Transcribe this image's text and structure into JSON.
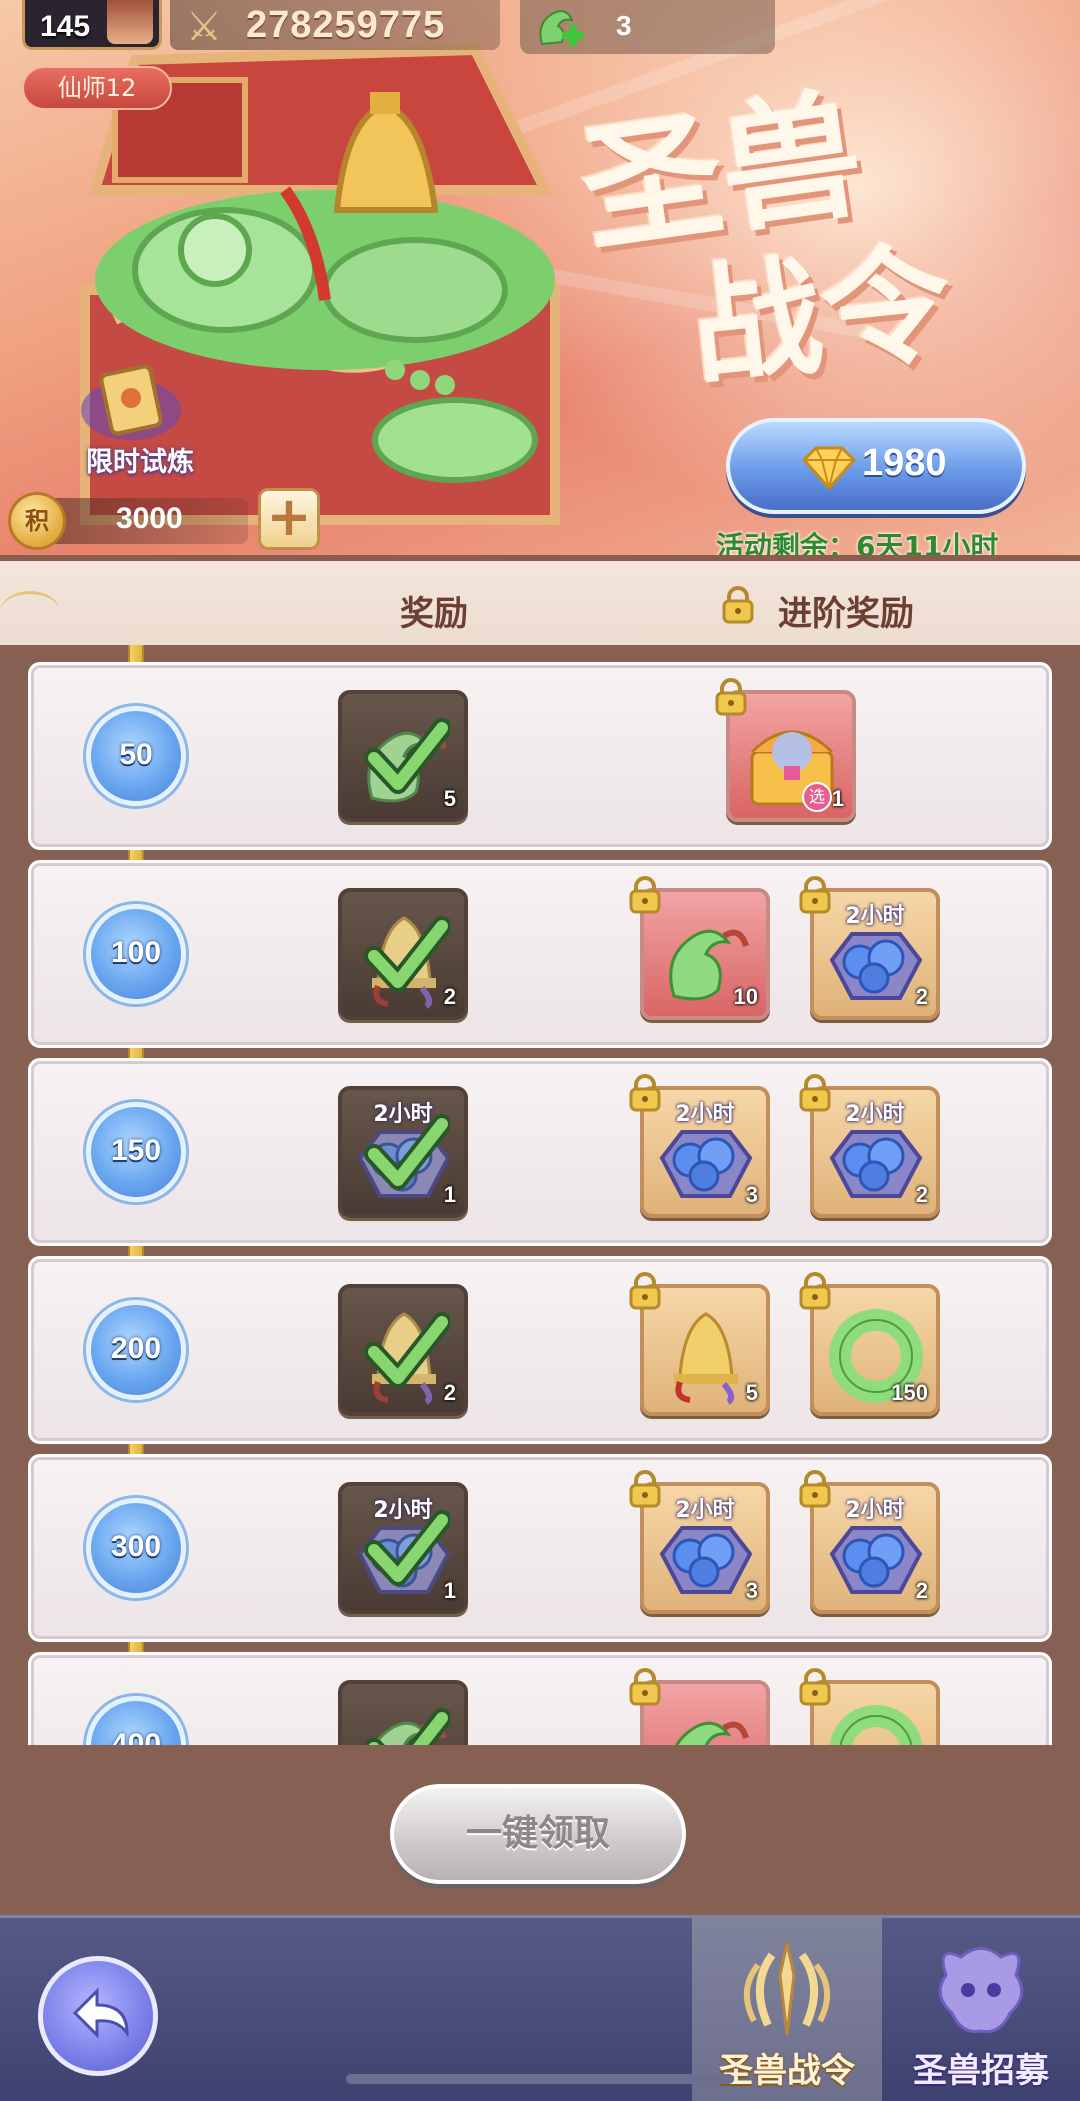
{
  "header": {
    "player_level": "145",
    "combat_power": "278259775",
    "beast_count": "3",
    "title_badge": "仙师12"
  },
  "event": {
    "title_line1": "圣兽",
    "title_line2": "战令",
    "trial_label": "限时试炼",
    "points_icon_text": "积",
    "points_value": "3000",
    "price": "1980",
    "remaining": "活动剩余：6天11小时"
  },
  "columns": {
    "reward": "奖励",
    "advanced_reward": "进阶奖励"
  },
  "tiers": [
    {
      "milestone": "50",
      "free": {
        "icon": "jade-dragon-icon",
        "qty": "5",
        "claimed": true
      },
      "premium": [
        {
          "icon": "treasure-chest-icon",
          "qty": "1",
          "bg": "red",
          "badge": "选"
        }
      ]
    },
    {
      "milestone": "100",
      "free": {
        "icon": "golden-bell-icon",
        "qty": "2",
        "claimed": true
      },
      "premium": [
        {
          "icon": "jade-dragon-icon",
          "qty": "10",
          "bg": "red"
        },
        {
          "icon": "blue-orb-chest-icon",
          "qty": "2",
          "bg": "gold",
          "duration": "2小时"
        }
      ]
    },
    {
      "milestone": "150",
      "free": {
        "icon": "blue-orb-chest-icon",
        "qty": "1",
        "claimed": true,
        "duration": "2小时"
      },
      "premium": [
        {
          "icon": "blue-orb-chest-icon",
          "qty": "3",
          "bg": "gold",
          "duration": "2小时"
        },
        {
          "icon": "blue-orb-chest-icon",
          "qty": "2",
          "bg": "gold",
          "duration": "2小时"
        }
      ]
    },
    {
      "milestone": "200",
      "free": {
        "icon": "golden-bell-icon",
        "qty": "2",
        "claimed": true
      },
      "premium": [
        {
          "icon": "golden-bell-icon",
          "qty": "5",
          "bg": "gold"
        },
        {
          "icon": "jade-ring-icon",
          "qty": "150",
          "bg": "gold"
        }
      ]
    },
    {
      "milestone": "300",
      "free": {
        "icon": "blue-orb-chest-icon",
        "qty": "1",
        "claimed": true,
        "duration": "2小时"
      },
      "premium": [
        {
          "icon": "blue-orb-chest-icon",
          "qty": "3",
          "bg": "gold",
          "duration": "2小时"
        },
        {
          "icon": "blue-orb-chest-icon",
          "qty": "2",
          "bg": "gold",
          "duration": "2小时"
        }
      ]
    },
    {
      "milestone": "400",
      "free": {
        "icon": "jade-dragon-icon",
        "qty": "",
        "claimed": true
      },
      "premium": [
        {
          "icon": "jade-dragon-icon",
          "qty": "",
          "bg": "red"
        },
        {
          "icon": "jade-ring-icon",
          "qty": "",
          "bg": "gold"
        }
      ]
    }
  ],
  "actions": {
    "claim_all": "一键领取"
  },
  "nav": {
    "tabs": [
      {
        "label": "圣兽战令",
        "icon": "beast-pass-icon",
        "active": true
      },
      {
        "label": "圣兽招募",
        "icon": "beast-summon-icon",
        "active": false
      }
    ]
  },
  "colors": {
    "panel": "#866052",
    "row_bg": "#f3eef0",
    "milestone_blue": "#6aa7ef",
    "track_gold": "#f3d16a",
    "remaining_green": "#2f8a2b",
    "nav_bg": "#4a4e7c"
  }
}
